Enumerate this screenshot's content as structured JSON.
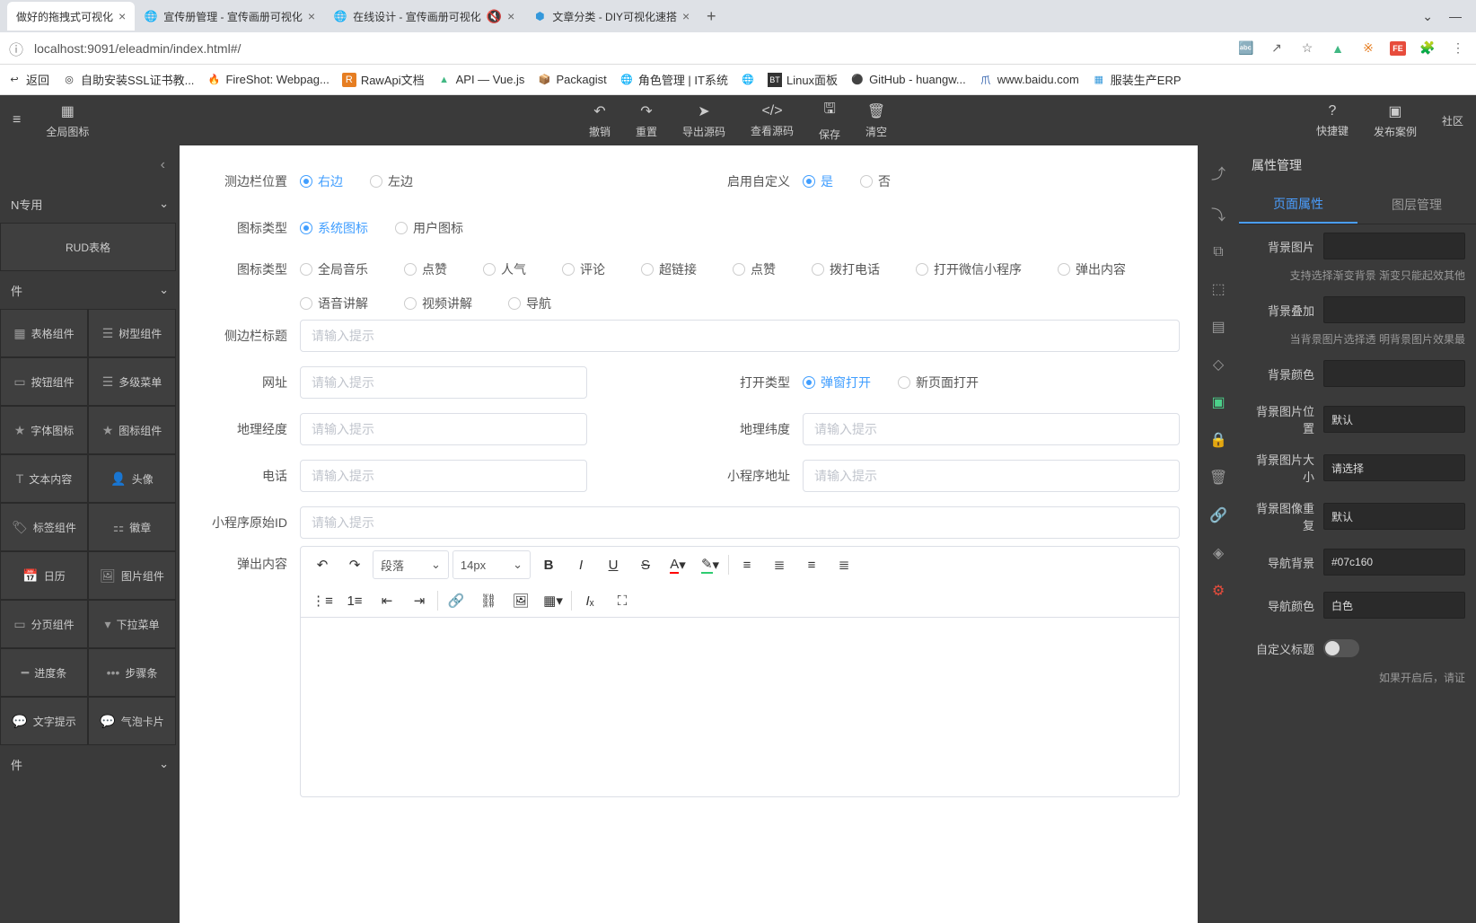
{
  "tabs": [
    {
      "label": "做好的拖拽式可视化",
      "active": true
    },
    {
      "label": "宣传册管理 - 宣传画册可视化"
    },
    {
      "label": "在线设计 - 宣传画册可视化"
    },
    {
      "label": "文章分类 - DIY可视化速搭"
    }
  ],
  "url": "localhost:9091/eleadmin/index.html#/",
  "bookmarks": [
    "返回",
    "自助安装SSL证书教...",
    "FireShot: Webpag...",
    "RawApi文档",
    "API — Vue.js",
    "Packagist",
    "角色管理 | IT系统",
    "Linux面板",
    "GitHub - huangw...",
    "www.baidu.com",
    "服装生产ERP"
  ],
  "toolbar": {
    "left": [
      {
        "ico": "▦",
        "label": "全局图标"
      }
    ],
    "center": [
      {
        "ico": "↶",
        "label": "撤销"
      },
      {
        "ico": "↷",
        "label": "重置"
      },
      {
        "ico": "➤",
        "label": "导出源码"
      },
      {
        "ico": "</>",
        "label": "查看源码"
      },
      {
        "ico": "🖫",
        "label": "保存"
      },
      {
        "ico": "🗑",
        "label": "清空"
      }
    ],
    "right": [
      {
        "ico": "?",
        "label": "快捷键"
      },
      {
        "ico": "▣",
        "label": "发布案例"
      },
      {
        "ico": "",
        "label": "社区"
      }
    ]
  },
  "leftpanel": {
    "cat1": "N专用",
    "item1": "RUD表格",
    "cat2": "件",
    "grid": [
      [
        "表格组件",
        "树型组件"
      ],
      [
        "按钮组件",
        "多级菜单"
      ],
      [
        "字体图标",
        "图标组件"
      ],
      [
        "文本内容",
        "头像"
      ],
      [
        "标签组件",
        "徽章"
      ],
      [
        "日历",
        "图片组件"
      ],
      [
        "分页组件",
        "下拉菜单"
      ],
      [
        "进度条",
        "步骤条"
      ],
      [
        "文字提示",
        "气泡卡片"
      ]
    ],
    "cat3": "件"
  },
  "form": {
    "row1": {
      "label": "测边栏位置",
      "opts": [
        "右边",
        "左边"
      ],
      "sel": 0,
      "label2": "启用自定义",
      "opts2": [
        "是",
        "否"
      ],
      "sel2": 0
    },
    "row2": {
      "label": "图标类型",
      "opts": [
        "系统图标",
        "用户图标"
      ],
      "sel": 0
    },
    "row3": {
      "label": "图标类型",
      "opts": [
        "全局音乐",
        "点赞",
        "人气",
        "评论",
        "超链接",
        "点赞",
        "拨打电话",
        "打开微信小程序",
        "弹出内容",
        "语音讲解",
        "视频讲解",
        "导航"
      ]
    },
    "sidebar_title": {
      "label": "侧边栏标题",
      "ph": "请输入提示"
    },
    "url": {
      "label": "网址",
      "ph": "请输入提示"
    },
    "opentype": {
      "label": "打开类型",
      "opts": [
        "弹窗打开",
        "新页面打开"
      ],
      "sel": 0
    },
    "lng": {
      "label": "地理经度",
      "ph": "请输入提示"
    },
    "lat": {
      "label": "地理纬度",
      "ph": "请输入提示"
    },
    "phone": {
      "label": "电话",
      "ph": "请输入提示"
    },
    "miniaddr": {
      "label": "小程序地址",
      "ph": "请输入提示"
    },
    "miniid": {
      "label": "小程序原始ID",
      "ph": "请输入提示"
    },
    "popup": {
      "label": "弹出内容"
    },
    "editor": {
      "format": "段落",
      "size": "14px"
    }
  },
  "rail": [
    "⇈",
    "⇊",
    "▢",
    "⬚",
    "▤",
    "◇",
    "▣",
    "⇵",
    "🗑",
    "🔗",
    "◈",
    "⚙"
  ],
  "right": {
    "title": "属性管理",
    "tabs": [
      "页面属性",
      "图层管理"
    ],
    "rows": [
      {
        "label": "背景图片",
        "type": "input",
        "val": "",
        "help": "支持选择渐变背景\n渐变只能起效其他"
      },
      {
        "label": "背景叠加",
        "type": "input",
        "val": "",
        "help": "当背景图片选择透\n明背景图片效果最"
      },
      {
        "label": "背景颜色",
        "type": "input",
        "val": ""
      },
      {
        "label": "背景图片位置",
        "type": "select",
        "val": "默认"
      },
      {
        "label": "背景图片大小",
        "type": "select",
        "val": "请选择"
      },
      {
        "label": "背景图像重复",
        "type": "select",
        "val": "默认"
      },
      {
        "label": "导航背景",
        "type": "input",
        "val": "#07c160"
      },
      {
        "label": "导航颜色",
        "type": "select",
        "val": "白色"
      },
      {
        "label": "自定义标题",
        "type": "toggle",
        "help": "如果开启后，请证"
      }
    ]
  }
}
